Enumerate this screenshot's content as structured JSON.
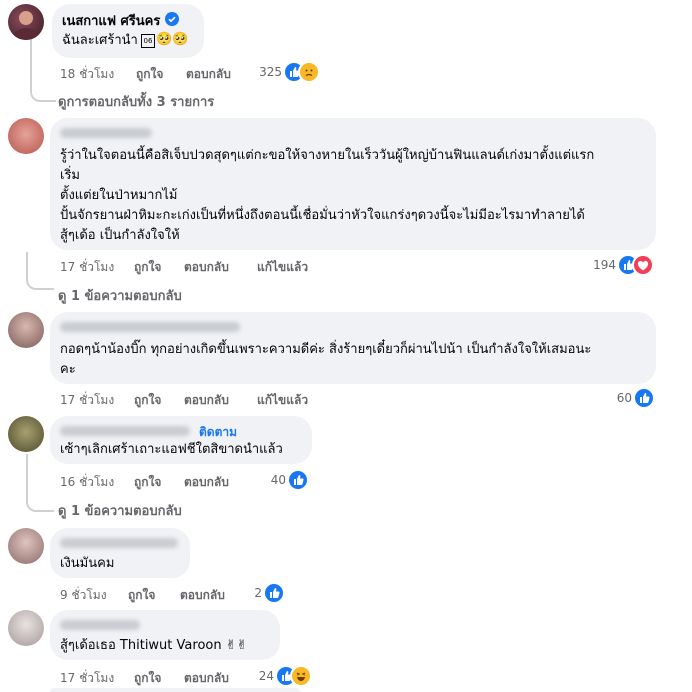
{
  "top_reply": {
    "author": "เนสกาแฟ ศรีนคร",
    "text": "ฉันละเศร้านำ",
    "emoji_box": "06",
    "emoji": "🥺🥺",
    "time": "18 ชั่วโมง",
    "like": "ถูกใจ",
    "reply": "ตอบกลับ",
    "reactions": "325"
  },
  "view_all_replies": "ดูการตอบกลับทั้ง 3 รายการ",
  "comments": [
    {
      "lines": [
        "รู้ว่าในใจตอนนี้คือสิเจ็บปวดสุดๆแต่กะขอให้จางหายในเร็ววันผู้ใหญ่บ้านฟินแลนด์เก่งมาตั้งแต่แรก",
        "เริ่ม",
        "ตั้งแต่ยในป่าหมากไม้",
        "ปั้นจักรยานฝ่าหิมะกะเก่งเป็นที่หนึ่งถึงตอนนี้เชื่อมั่นว่าหัวใจแกร่งๆดวงนี้จะไม่มีอะไรมาทำลายได้",
        "สู้ๆเด้อ เป็นกำลังใจให้"
      ],
      "time": "17 ชั่วโมง",
      "like": "ถูกใจ",
      "reply": "ตอบกลับ",
      "edited": "แก้ไขแล้ว",
      "reactions": "194",
      "replies": "ดู 1 ข้อความตอบกลับ"
    },
    {
      "lines": [
        "กอดๆน้าน้องบิ๊ก ทุกอย่างเกิดขึ้นเพราะความดีค่ะ สิ่งร้ายๆเดี๋ยวก็ผ่านไปน้า เป็นกำลังใจให้เสมอนะ",
        "คะ"
      ],
      "time": "17 ชั่วโมง",
      "like": "ถูกใจ",
      "reply": "ตอบกลับ",
      "edited": "แก้ไขแล้ว",
      "reactions": "60"
    },
    {
      "follow": "ติดตาม",
      "lines": [
        "เซ้าๆเลิกเศร้าเถาะแอฟชีใตสิขาดนำแล้ว"
      ],
      "time": "16 ชั่วโมง",
      "like": "ถูกใจ",
      "reply": "ตอบกลับ",
      "reactions": "40",
      "replies": "ดู 1 ข้อความตอบกลับ"
    },
    {
      "lines": [
        "เงินมันคม"
      ],
      "time": "9 ชั่วโมง",
      "like": "ถูกใจ",
      "reply": "ตอบกลับ",
      "reactions": "2"
    },
    {
      "lines": [
        "สู้ๆเด้อเธอ Thitiwut Varoon ✌✌"
      ],
      "time": "17 ชั่วโมง",
      "like": "ถูกใจ",
      "reply": "ตอบกลับ",
      "reactions": "24"
    }
  ],
  "colors": {
    "like": "#1877f2",
    "love": "#f33e58",
    "meta": "#65676b",
    "bubble": "#f0f2f5"
  }
}
